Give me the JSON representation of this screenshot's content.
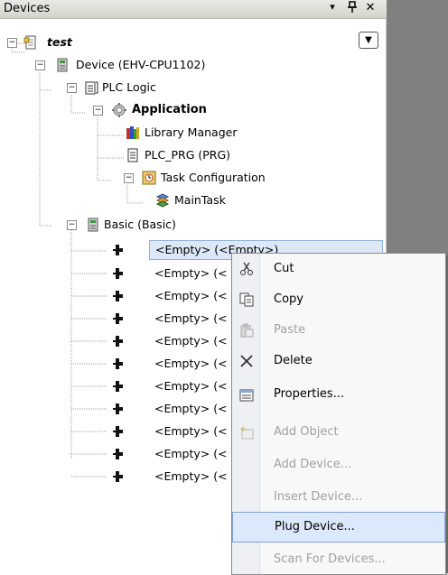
{
  "panel": {
    "title": "Devices",
    "buttons": {
      "menu": "▾",
      "pin": "ᵾ",
      "close": "✕"
    }
  },
  "tree": {
    "root": "test",
    "device": "Device (EHV-CPU1102)",
    "plc_logic": "PLC Logic",
    "application": "Application",
    "library_manager": "Library Manager",
    "plc_prg": "PLC_PRG (PRG)",
    "task_configuration": "Task Configuration",
    "main_task": "MainTask",
    "basic": "Basic (Basic)",
    "slots": [
      "<Empty> (<Empty>)",
      "<Empty> (<",
      "<Empty> (<",
      "<Empty> (<",
      "<Empty> (<",
      "<Empty> (<",
      "<Empty> (<",
      "<Empty> (<",
      "<Empty> (<",
      "<Empty> (<",
      "<Empty> (<"
    ]
  },
  "context_menu": {
    "items": [
      {
        "label": "Cut",
        "icon": "scissors-icon",
        "enabled": true
      },
      {
        "label": "Copy",
        "icon": "copy-icon",
        "enabled": true
      },
      {
        "label": "Paste",
        "icon": "paste-icon",
        "enabled": false
      },
      {
        "label": "Delete",
        "icon": "delete-icon",
        "enabled": true
      },
      {
        "label": "Properties...",
        "icon": "properties-icon",
        "enabled": true
      },
      {
        "label": "Add Object",
        "icon": "add-object-icon",
        "enabled": false
      },
      {
        "label": "Add Device...",
        "icon": "",
        "enabled": false
      },
      {
        "label": "Insert Device...",
        "icon": "",
        "enabled": false
      },
      {
        "label": "Plug Device...",
        "icon": "",
        "enabled": true,
        "highlighted": true
      },
      {
        "label": "Scan For Devices...",
        "icon": "",
        "enabled": false
      }
    ]
  },
  "colors": {
    "selection_bg": "#dce7f7",
    "menu_highlight": "#dce8fb",
    "disabled_text": "#a0a0a0",
    "background_gray": "#808080"
  }
}
